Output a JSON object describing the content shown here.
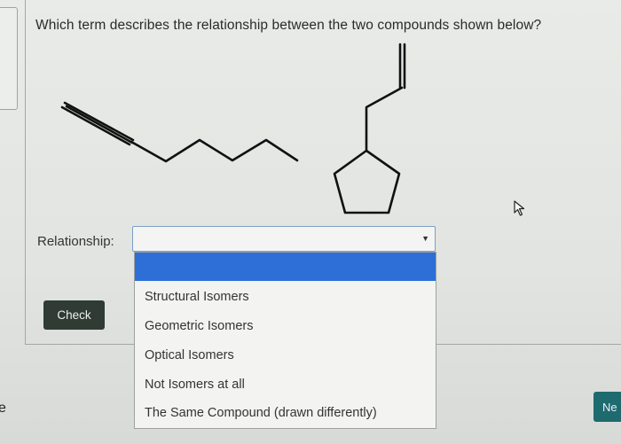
{
  "question": {
    "text": "Which term describes the relationship between the two compounds shown below?"
  },
  "relationship": {
    "label": "Relationship:",
    "selected_value": ""
  },
  "dropdown": {
    "options": [
      "Structural Isomers",
      "Geometric Isomers",
      "Optical Isomers",
      "Not Isomers at all",
      "The Same Compound (drawn differently)"
    ]
  },
  "buttons": {
    "check_label": "Check",
    "next_label": "Ne"
  },
  "left_edge": {
    "char": "e"
  },
  "colors": {
    "highlight": "#2d6fd6",
    "check_button": "#2f3b33",
    "next_button": "#1e6b6f"
  }
}
